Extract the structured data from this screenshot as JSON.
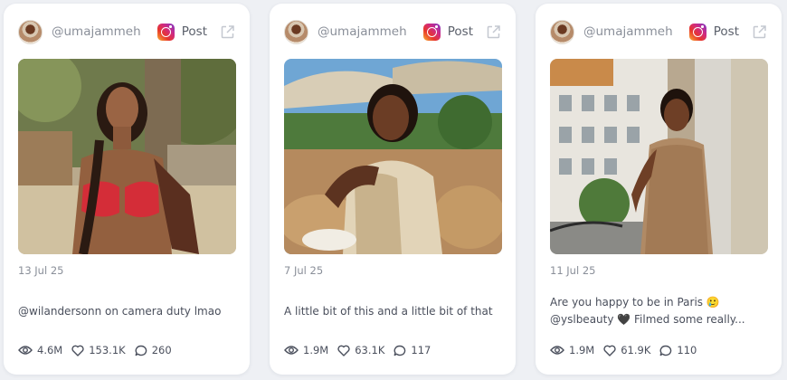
{
  "cards": [
    {
      "handle": "@umajammeh",
      "post_label": "Post",
      "date": "13 Jul 25",
      "caption": "@wilandersonn on camera duty lmao",
      "views": "4.6M",
      "likes": "153.1K",
      "comments": "260"
    },
    {
      "handle": "@umajammeh",
      "post_label": "Post",
      "date": "7 Jul 25",
      "caption": "A little bit of this and a little bit of that",
      "views": "1.9M",
      "likes": "63.1K",
      "comments": "117"
    },
    {
      "handle": "@umajammeh",
      "post_label": "Post",
      "date": "11 Jul 25",
      "caption": "Are you happy to be in Paris 🥲 @yslbeauty 🖤 Filmed some really...",
      "views": "1.9M",
      "likes": "61.9K",
      "comments": "110"
    }
  ],
  "icons": {
    "platform": "instagram-icon",
    "open": "external-link-icon",
    "views": "eye-icon",
    "likes": "heart-icon",
    "comments": "comment-icon"
  },
  "colors": {
    "card_bg": "#ffffff",
    "page_bg": "#eef0f4",
    "muted_text": "#8a8f99",
    "body_text": "#4a4f5c"
  }
}
